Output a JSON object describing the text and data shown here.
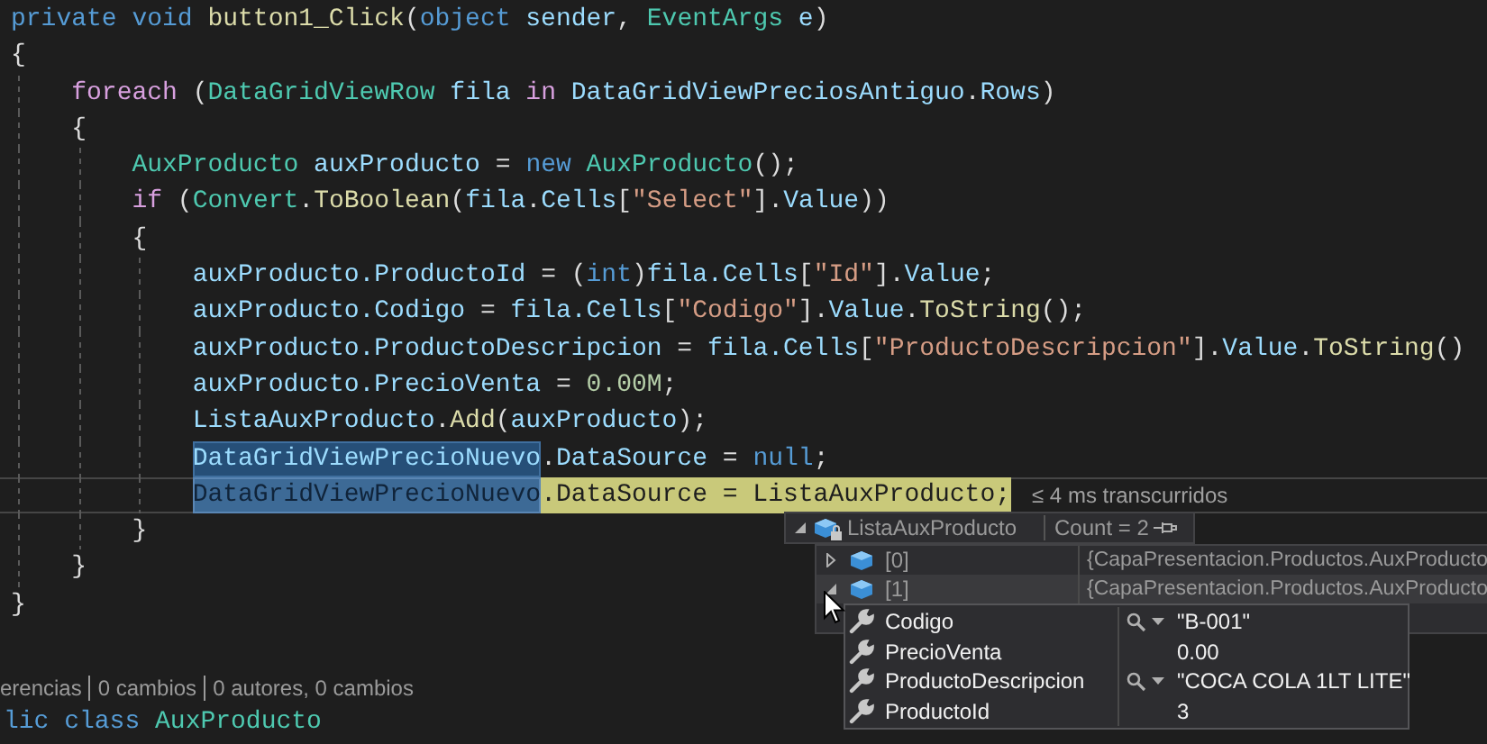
{
  "editor": {
    "lines": [
      {
        "tokens": [
          {
            "kind": "kw",
            "text": "private void "
          },
          {
            "kind": "fn",
            "text": "button1_Click"
          },
          {
            "kind": "punct",
            "text": "("
          },
          {
            "kind": "kw",
            "text": "object "
          },
          {
            "kind": "var",
            "text": "sender"
          },
          {
            "kind": "punct",
            "text": ", "
          },
          {
            "kind": "type",
            "text": "EventArgs "
          },
          {
            "kind": "var",
            "text": "e"
          },
          {
            "kind": "punct",
            "text": ")"
          }
        ]
      },
      {
        "tokens": [
          {
            "kind": "punct",
            "text": "{"
          }
        ]
      },
      {
        "tokens": [
          {
            "kind": "ctl",
            "text": "    foreach"
          },
          {
            "kind": "punct",
            "text": " ("
          },
          {
            "kind": "type",
            "text": "DataGridViewRow"
          },
          {
            "kind": "var",
            "text": " fila"
          },
          {
            "kind": "ctl",
            "text": " in "
          },
          {
            "kind": "var",
            "text": "DataGridViewPreciosAntiguo"
          },
          {
            "kind": "punct",
            "text": "."
          },
          {
            "kind": "var",
            "text": "Rows"
          },
          {
            "kind": "punct",
            "text": ")"
          }
        ]
      },
      {
        "tokens": [
          {
            "kind": "punct",
            "text": "    {"
          }
        ]
      },
      {
        "tokens": [
          {
            "kind": "type",
            "text": "        AuxProducto"
          },
          {
            "kind": "var",
            "text": " auxProducto"
          },
          {
            "kind": "punct",
            "text": " = "
          },
          {
            "kind": "kw",
            "text": "new "
          },
          {
            "kind": "type",
            "text": "AuxProducto"
          },
          {
            "kind": "punct",
            "text": "();"
          }
        ]
      },
      {
        "tokens": [
          {
            "kind": "ctl",
            "text": "        if"
          },
          {
            "kind": "punct",
            "text": " ("
          },
          {
            "kind": "type",
            "text": "Convert"
          },
          {
            "kind": "punct",
            "text": "."
          },
          {
            "kind": "fn",
            "text": "ToBoolean"
          },
          {
            "kind": "punct",
            "text": "("
          },
          {
            "kind": "var",
            "text": "fila"
          },
          {
            "kind": "punct",
            "text": "."
          },
          {
            "kind": "var",
            "text": "Cells"
          },
          {
            "kind": "punct",
            "text": "["
          },
          {
            "kind": "str",
            "text": "\"Select\""
          },
          {
            "kind": "punct",
            "text": "]."
          },
          {
            "kind": "var",
            "text": "Value"
          },
          {
            "kind": "punct",
            "text": "))"
          }
        ]
      },
      {
        "tokens": [
          {
            "kind": "punct",
            "text": "        {"
          }
        ]
      },
      {
        "tokens": [
          {
            "kind": "var",
            "text": "            auxProducto.ProductoId"
          },
          {
            "kind": "punct",
            "text": " = ("
          },
          {
            "kind": "kw",
            "text": "int"
          },
          {
            "kind": "punct",
            "text": ")"
          },
          {
            "kind": "var",
            "text": "fila.Cells"
          },
          {
            "kind": "punct",
            "text": "["
          },
          {
            "kind": "str",
            "text": "\"Id\""
          },
          {
            "kind": "punct",
            "text": "]."
          },
          {
            "kind": "var",
            "text": "Value"
          },
          {
            "kind": "punct",
            "text": ";"
          }
        ]
      },
      {
        "tokens": [
          {
            "kind": "var",
            "text": "            auxProducto.Codigo"
          },
          {
            "kind": "punct",
            "text": " = "
          },
          {
            "kind": "var",
            "text": "fila.Cells"
          },
          {
            "kind": "punct",
            "text": "["
          },
          {
            "kind": "str",
            "text": "\"Codigo\""
          },
          {
            "kind": "punct",
            "text": "]."
          },
          {
            "kind": "var",
            "text": "Value"
          },
          {
            "kind": "punct",
            "text": "."
          },
          {
            "kind": "fn",
            "text": "ToString"
          },
          {
            "kind": "punct",
            "text": "();"
          }
        ]
      },
      {
        "tokens": [
          {
            "kind": "var",
            "text": "            auxProducto.ProductoDescripcion"
          },
          {
            "kind": "punct",
            "text": " = "
          },
          {
            "kind": "var",
            "text": "fila.Cells"
          },
          {
            "kind": "punct",
            "text": "["
          },
          {
            "kind": "str",
            "text": "\"ProductoDescripcion\""
          },
          {
            "kind": "punct",
            "text": "]."
          },
          {
            "kind": "var",
            "text": "Value"
          },
          {
            "kind": "punct",
            "text": "."
          },
          {
            "kind": "fn",
            "text": "ToString"
          },
          {
            "kind": "punct",
            "text": "()"
          }
        ]
      },
      {
        "tokens": [
          {
            "kind": "var",
            "text": "            auxProducto.PrecioVenta"
          },
          {
            "kind": "punct",
            "text": " = "
          },
          {
            "kind": "num",
            "text": "0.00M"
          },
          {
            "kind": "punct",
            "text": ";"
          }
        ]
      },
      {
        "tokens": [
          {
            "kind": "var",
            "text": "            ListaAuxProducto"
          },
          {
            "kind": "punct",
            "text": "."
          },
          {
            "kind": "fn",
            "text": "Add"
          },
          {
            "kind": "punct",
            "text": "("
          },
          {
            "kind": "var",
            "text": "auxProducto"
          },
          {
            "kind": "punct",
            "text": ");"
          }
        ]
      },
      {
        "tokens": [
          {
            "kind": "var",
            "text": "            DataGridViewPrecioNuevo",
            "selected": true
          },
          {
            "kind": "punct",
            "text": "."
          },
          {
            "kind": "var",
            "text": "DataSource"
          },
          {
            "kind": "punct",
            "text": " = "
          },
          {
            "kind": "kw",
            "text": "null"
          },
          {
            "kind": "punct",
            "text": ";"
          }
        ]
      },
      {
        "current": true,
        "perf_tip": "≤ 4 ms transcurridos",
        "tokens": [
          {
            "kind": "var",
            "text": "            DataGridViewPrecioNuevo",
            "selected": true,
            "current_statement": true
          },
          {
            "kind": "punct",
            "text": ".DataSource = ListaAuxProducto;",
            "current_statement": true
          }
        ]
      },
      {
        "tokens": [
          {
            "kind": "punct",
            "text": "        }"
          }
        ]
      },
      {
        "tokens": [
          {
            "kind": "punct",
            "text": "    }"
          }
        ]
      },
      {
        "tokens": [
          {
            "kind": "punct",
            "text": "}"
          }
        ]
      }
    ]
  },
  "codelens": [
    "erencias",
    "0 cambios",
    "0 autores, 0 cambios"
  ],
  "next_line": {
    "tokens": [
      {
        "kind": "kw",
        "text": "lic class "
      },
      {
        "kind": "type",
        "text": "AuxProducto"
      }
    ]
  },
  "datatip": {
    "name": "ListaAuxProducto",
    "count": "Count = 2",
    "expanded": true,
    "items": [
      {
        "name": "[0]",
        "value": "{CapaPresentacion.Productos.AuxProducto",
        "expanded": false,
        "selected": false
      },
      {
        "name": "[1]",
        "value": "{CapaPresentacion.Productos.AuxProducto",
        "expanded": true,
        "selected": true,
        "children": [
          {
            "name": "Codigo",
            "value": "\"B-001\"",
            "kind": "string"
          },
          {
            "name": "PrecioVenta",
            "value": "0.00",
            "kind": "number"
          },
          {
            "name": "ProductoDescripcion",
            "value": "\"COCA COLA 1LT LITE\"",
            "kind": "string"
          },
          {
            "name": "ProductoId",
            "value": "3",
            "kind": "number"
          }
        ]
      }
    ]
  }
}
